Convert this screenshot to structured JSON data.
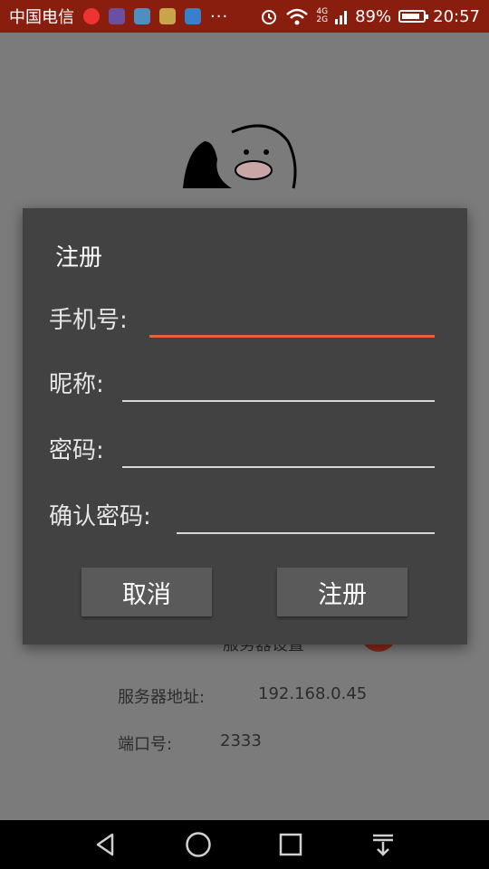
{
  "status_bar": {
    "carrier": "中国电信",
    "more": "···",
    "network": [
      "4G",
      "2G"
    ],
    "battery_percent": "89%",
    "battery_level": 0.89,
    "time": "20:57"
  },
  "background": {
    "server_settings_partial": "服务器设置",
    "server_address_label": "服务器地址:",
    "server_address_value": "192.168.0.45",
    "port_label": "端口号:",
    "port_value": "2333"
  },
  "dialog": {
    "title": "注册",
    "fields": [
      {
        "label": "手机号:",
        "value": ""
      },
      {
        "label": "昵称:",
        "value": ""
      },
      {
        "label": "密码:",
        "value": ""
      },
      {
        "label": "确认密码:",
        "value": ""
      }
    ],
    "cancel_label": "取消",
    "register_label": "注册",
    "accent_color": "#e8613e"
  },
  "nav_bar": {
    "icons": [
      "back-icon",
      "home-icon",
      "recents-icon",
      "notification-drawer-icon"
    ]
  }
}
